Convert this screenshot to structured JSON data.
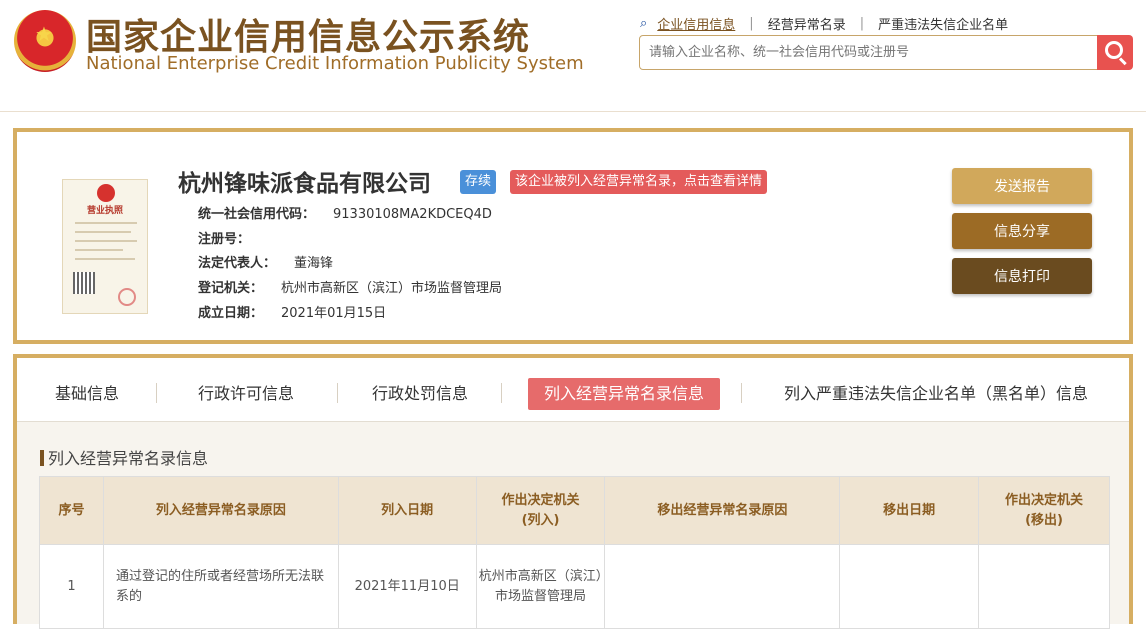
{
  "header": {
    "title_cn": "国家企业信用信息公示系统",
    "title_en": "National Enterprise Credit Information Publicity System",
    "search_icon": "search-icon",
    "nav": [
      "企业信用信息",
      "经营异常名录",
      "严重违法失信企业名单"
    ],
    "search_placeholder": "请输入企业名称、统一社会信用代码或注册号",
    "search_button_icon": "magnifier-icon"
  },
  "company": {
    "license_label": "营业执照",
    "name": "杭州锋味派食品有限公司",
    "status": "存续",
    "warning": "该企业被列入经营异常名录，点击查看详情",
    "fields": [
      {
        "label": "统一社会信用代码：",
        "value": "91330108MA2KDCEQ4D"
      },
      {
        "label": "注册号：",
        "value": ""
      },
      {
        "label": "法定代表人：",
        "value": "董海锋"
      },
      {
        "label": "登记机关：",
        "value": "杭州市高新区（滨江）市场监督管理局"
      },
      {
        "label": "成立日期：",
        "value": "2021年01月15日"
      }
    ],
    "actions": [
      "发送报告",
      "信息分享",
      "信息打印"
    ]
  },
  "tabs": [
    "基础信息",
    "行政许可信息",
    "行政处罚信息",
    "列入经营异常名录信息",
    "列入严重违法失信企业名单（黑名单）信息"
  ],
  "section": {
    "title": "列入经营异常名录信息",
    "table": {
      "headers": [
        "序号",
        "列入经营异常名录原因",
        "列入日期",
        "作出决定机关\n(列入)",
        "移出经营异常名录原因",
        "移出日期",
        "作出决定机关\n(移出)"
      ],
      "rows": [
        [
          "1",
          "通过登记的住所或者经营场所无法联系的",
          "2021年11月10日",
          "杭州市高新区（滨江）市场监督管理局",
          "",
          "",
          ""
        ]
      ]
    }
  },
  "colors": {
    "brand": "#7a5220",
    "accent": "#d6ae62",
    "warning": "#e45b5b",
    "status": "#4a90d9"
  }
}
